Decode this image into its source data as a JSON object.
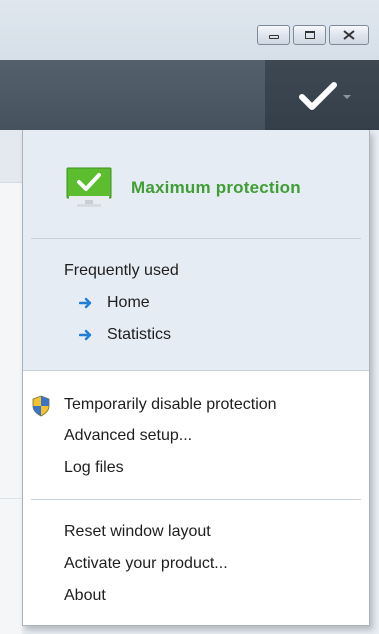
{
  "window": {
    "buttons": [
      "minimize",
      "maximize",
      "close"
    ]
  },
  "toolbar": {
    "status_icon": "checkmark-icon",
    "status_caret": "chevron-down-icon"
  },
  "menu": {
    "status": {
      "label": "Maximum protection",
      "icon": "monitor-check-icon",
      "color": "#3f9e34"
    },
    "frequently_used": {
      "heading": "Frequently used",
      "items": [
        {
          "label": "Home",
          "icon": "arrow-right-icon"
        },
        {
          "label": "Statistics",
          "icon": "arrow-right-icon"
        }
      ]
    },
    "actions": [
      {
        "label": "Temporarily disable protection",
        "icon": "uac-shield-icon"
      },
      {
        "label": "Advanced setup..."
      },
      {
        "label": "Log files"
      }
    ],
    "footer": [
      {
        "label": "Reset window layout"
      },
      {
        "label": "Activate your product..."
      },
      {
        "label": "About"
      }
    ]
  },
  "colors": {
    "toolbar": "#4a5662",
    "accent_arrow": "#1e7fd8",
    "status_green": "#3f9e34"
  }
}
